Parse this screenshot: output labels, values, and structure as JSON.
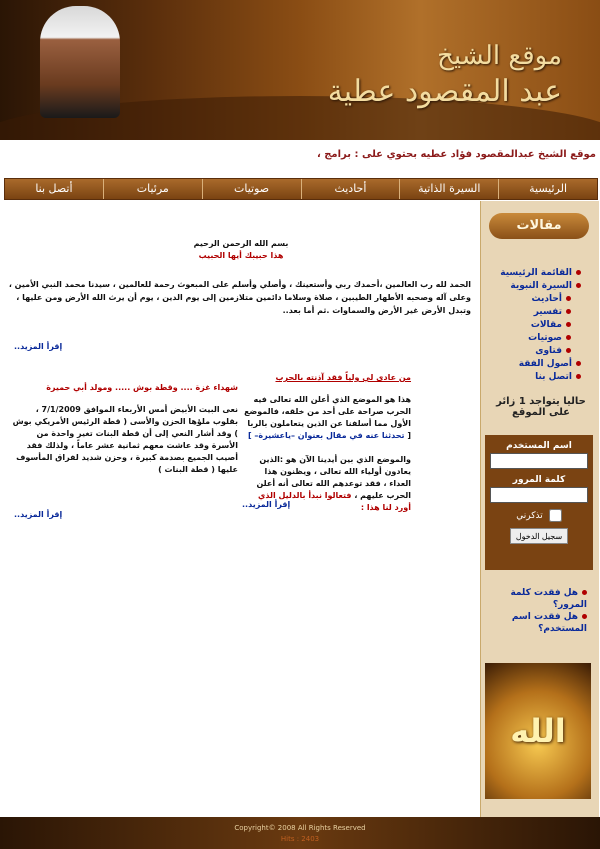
{
  "header": {
    "title_line1": "موقع الشيخ",
    "title_line2": "عبد المقصود عطية"
  },
  "marquee": "موقع الشيخ عبدالمقصود فؤاد عطيه بحتوي على : برامج ،",
  "nav": [
    "الرئيسية",
    "السيرة الذاتية",
    "أحاديث",
    "صوتيات",
    "مرئيات",
    "أتصل بنا"
  ],
  "sidebar": {
    "title": "مقالات",
    "menu": [
      {
        "label": "القائمة الرئيسية",
        "sub": false
      },
      {
        "label": "السيرة النبوية",
        "sub": false
      },
      {
        "label": "أحاديث",
        "sub": true
      },
      {
        "label": "تفسير",
        "sub": true
      },
      {
        "label": "مقالات",
        "sub": true
      },
      {
        "label": "صوتيات",
        "sub": true
      },
      {
        "label": "فتاوى",
        "sub": true
      },
      {
        "label": "أصول الفقة",
        "sub": false
      },
      {
        "label": "اتصل بنا",
        "sub": false
      }
    ],
    "visitors": "حاليا يتواجد 1 زائر على الموقع",
    "login": {
      "username_label": "اسم المستخدم",
      "password_label": "كلمة المرور",
      "remember_label": "تذكرني",
      "button": "سجيل الدخول"
    },
    "links": [
      "هل فقدت كلمة المرور؟",
      "هل فقدت اسم المستخدم؟"
    ],
    "image_text": "الله"
  },
  "content": {
    "intro_title": "بسم الله الرحمن الرحيم",
    "intro_sub": "هذا حبيبك أيها الحبيب",
    "intro_body": "الحمد لله رب العالمين ،أحمدك ربي وأستعينك ، وأصلي وأسلم على المبعوث رحمة للعالمين ، سيدنا محمد النبي الأمين ، وعلى آله وصحبه الأطهار الطيبين ، صلاة وسلاما دائمين متلازمين إلى يوم الدين ، يوم أن يرث الله الأرض ومن عليها ، وتبدل الأرض غير الأرض والسماوات .ثم أما بعد..",
    "more": "إقرأ المزيد..",
    "article1": {
      "title": "من عادى لي ولياً فقد آذنته بالحرب",
      "body1": "هذا هو الموضع الذي أعلن الله تعالى فيه الحرب صراحة على أحد من خلقه، فالموضع الأول مما أسلفنا عن الذين يتعاملون بالربا [",
      "body_blue": "تحدثنا عنه في مقال بعنوان –ياعشيرة– ]",
      "body2": "والموضع الذي بين أيدينا الآن هو :الذين يعادون أولياء الله تعالى ، ويظنون هذا العداء ، فقد توعدهم الله تعالى أنه أعلن الحرب عليهم ،",
      "body_red": "فتعالوا نبدأ بالدليل الذي أورد لنا هذا :"
    },
    "article2": {
      "title": "شهداء غزة .... وقطة بوش ..... ومولد أبي حميرة",
      "body": "نعى البيت الأبيض أمس الأربعاء الموافق 7/1/2009 ، بقلوب ملؤها الحزن والأسى ( قطة الرئيس الأمريكي بوش ) وقد أشار النعي إلى أن قطة البنات تغير واحدة من الأسرة وقد عاشت معهم ثمانية عشر عاماً ، ولذلك فقد أصيب الجميع بصدمة كبيرة ، وحزن شديد لفراق المأسوف عليها ( قطة البنات )"
    }
  },
  "footer": {
    "copyright": "Copyright© 2008 All Rights Reserved",
    "hits": "Hits : 2403"
  },
  "colors": {
    "accent": "#7a4312",
    "link": "#0a2a9a",
    "highlight": "#b00000"
  }
}
